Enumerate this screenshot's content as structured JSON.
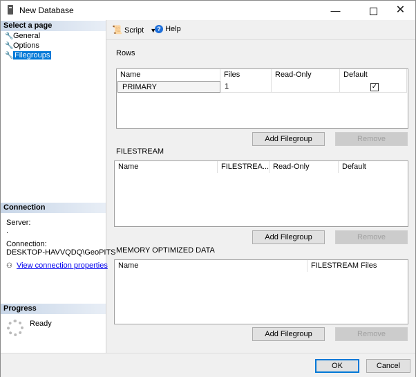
{
  "window": {
    "title": "New Database",
    "minimize": "—",
    "close": "✕"
  },
  "left": {
    "select_page": "Select a page",
    "pages": [
      {
        "label": "General",
        "icon": "wrench-icon"
      },
      {
        "label": "Options",
        "icon": "wrench-icon"
      },
      {
        "label": "Filegroups",
        "icon": "wrench-icon",
        "selected": true
      }
    ],
    "connection_head": "Connection",
    "server_label": "Server:",
    "server_value": ".",
    "connection_label": "Connection:",
    "connection_value": "DESKTOP-HAVVQDQ\\GeoPITS",
    "view_props": "View connection properties",
    "progress_head": "Progress",
    "progress_status": "Ready"
  },
  "toolbar": {
    "script": "Script",
    "help": "Help"
  },
  "rows": {
    "label": "Rows",
    "columns": [
      "Name",
      "Files",
      "Read-Only",
      "Default"
    ],
    "data": [
      {
        "name": "PRIMARY",
        "files": "1",
        "readonly": false,
        "default": true
      }
    ],
    "add": "Add Filegroup",
    "remove": "Remove"
  },
  "filestream": {
    "label": "FILESTREAM",
    "columns": [
      "Name",
      "FILESTREA...",
      "Read-Only",
      "Default"
    ],
    "add": "Add Filegroup",
    "remove": "Remove"
  },
  "memory": {
    "label": "MEMORY OPTIMIZED DATA",
    "columns": [
      "Name",
      "FILESTREAM Files"
    ],
    "add": "Add Filegroup",
    "remove": "Remove"
  },
  "footer": {
    "ok": "OK",
    "cancel": "Cancel"
  },
  "colors": {
    "accent": "#0078d7",
    "section_head": "#c8d6e8",
    "link": "#0000ee"
  }
}
